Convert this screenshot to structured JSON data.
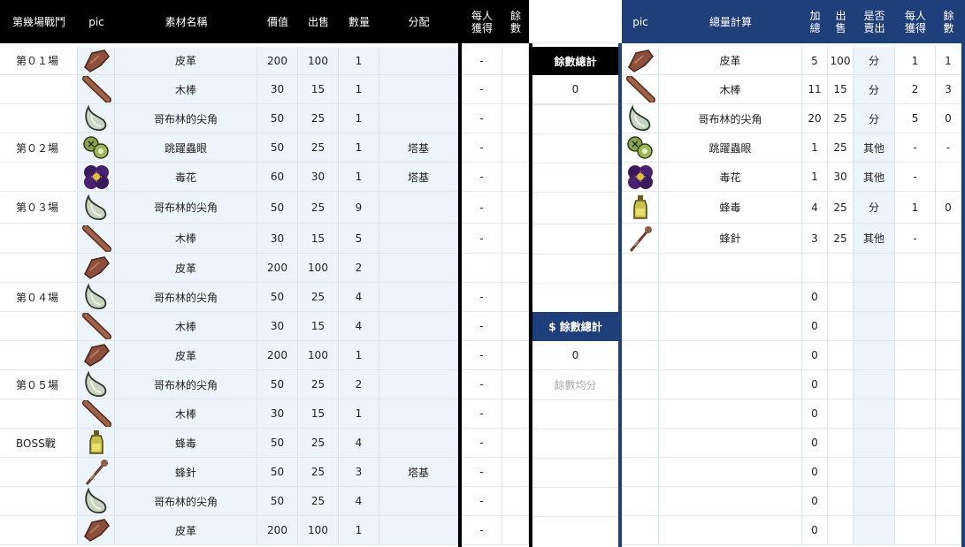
{
  "left_headers": [
    "第幾場戰鬥",
    "pic",
    "素材名稱",
    "價值",
    "出售",
    "數量",
    "分配",
    "每人\n獲得",
    "餘\n數"
  ],
  "left_rows": [
    {
      "battle": "第０１場",
      "icon": "leather-icon",
      "name": "皮革",
      "value": "200",
      "sell": "100",
      "qty": "1",
      "assign": "",
      "per": "-"
    },
    {
      "battle": "",
      "icon": "wooden-stick-icon",
      "name": "木棒",
      "value": "30",
      "sell": "15",
      "qty": "1",
      "assign": "",
      "per": "-"
    },
    {
      "battle": "",
      "icon": "goblin-horn-icon",
      "name": "哥布林的尖角",
      "value": "50",
      "sell": "25",
      "qty": "1",
      "assign": "",
      "per": "-"
    },
    {
      "battle": "第０２場",
      "icon": "bug-eye-icon",
      "name": "跳躍蟲眼",
      "value": "50",
      "sell": "25",
      "qty": "1",
      "assign": "塔基",
      "per": "-"
    },
    {
      "battle": "",
      "icon": "poison-flower-icon",
      "name": "毒花",
      "value": "60",
      "sell": "30",
      "qty": "1",
      "assign": "塔基",
      "per": "-"
    },
    {
      "battle": "第０３場",
      "icon": "goblin-horn-icon",
      "name": "哥布林的尖角",
      "value": "50",
      "sell": "25",
      "qty": "9",
      "assign": "",
      "per": "-"
    },
    {
      "battle": "",
      "icon": "wooden-stick-icon",
      "name": "木棒",
      "value": "30",
      "sell": "15",
      "qty": "5",
      "assign": "",
      "per": "-"
    },
    {
      "battle": "",
      "icon": "leather-icon",
      "name": "皮革",
      "value": "200",
      "sell": "100",
      "qty": "2",
      "assign": "",
      "per": ""
    },
    {
      "battle": "第０４場",
      "icon": "goblin-horn-icon",
      "name": "哥布林的尖角",
      "value": "50",
      "sell": "25",
      "qty": "4",
      "assign": "",
      "per": "-"
    },
    {
      "battle": "",
      "icon": "wooden-stick-icon",
      "name": "木棒",
      "value": "30",
      "sell": "15",
      "qty": "4",
      "assign": "",
      "per": "-"
    },
    {
      "battle": "",
      "icon": "leather-icon",
      "name": "皮革",
      "value": "200",
      "sell": "100",
      "qty": "1",
      "assign": "",
      "per": "-"
    },
    {
      "battle": "第０５場",
      "icon": "goblin-horn-icon",
      "name": "哥布林的尖角",
      "value": "50",
      "sell": "25",
      "qty": "2",
      "assign": "",
      "per": "-"
    },
    {
      "battle": "",
      "icon": "wooden-stick-icon",
      "name": "木棒",
      "value": "30",
      "sell": "15",
      "qty": "1",
      "assign": "",
      "per": "-"
    },
    {
      "battle": "BOSS戰",
      "icon": "bee-venom-icon",
      "name": "蜂毒",
      "value": "50",
      "sell": "25",
      "qty": "4",
      "assign": "",
      "per": "-"
    },
    {
      "battle": "",
      "icon": "bee-stinger-icon",
      "name": "蜂針",
      "value": "50",
      "sell": "25",
      "qty": "3",
      "assign": "塔基",
      "per": "-"
    },
    {
      "battle": "",
      "icon": "goblin-horn-icon",
      "name": "哥布林的尖角",
      "value": "50",
      "sell": "25",
      "qty": "4",
      "assign": "",
      "per": "-"
    },
    {
      "battle": "",
      "icon": "leather-icon",
      "name": "皮革",
      "value": "200",
      "sell": "100",
      "qty": "1",
      "assign": "",
      "per": "-"
    }
  ],
  "middle": {
    "remainder_total_label": "餘數總計",
    "remainder_total_value": "0",
    "money_remainder_label": "$ 餘數總計",
    "money_remainder_value": "0",
    "remainder_split_label": "餘數均分"
  },
  "right_headers": [
    "pic",
    "總量計算",
    "加\n總",
    "出\n售",
    "是否\n賣出",
    "每人\n獲得",
    "餘\n數"
  ],
  "right_rows": [
    {
      "icon": "leather-icon",
      "name": "皮革",
      "total": "5",
      "sell": "100",
      "sold": "分",
      "per": "1",
      "rem": "1"
    },
    {
      "icon": "wooden-stick-icon",
      "name": "木棒",
      "total": "11",
      "sell": "15",
      "sold": "分",
      "per": "2",
      "rem": "3"
    },
    {
      "icon": "goblin-horn-icon",
      "name": "哥布林的尖角",
      "total": "20",
      "sell": "25",
      "sold": "分",
      "per": "5",
      "rem": "0"
    },
    {
      "icon": "bug-eye-icon",
      "name": "跳躍蟲眼",
      "total": "1",
      "sell": "25",
      "sold": "其他",
      "per": "-",
      "rem": "-"
    },
    {
      "icon": "poison-flower-icon",
      "name": "毒花",
      "total": "1",
      "sell": "30",
      "sold": "其他",
      "per": "-",
      "rem": ""
    },
    {
      "icon": "bee-venom-icon",
      "name": "蜂毒",
      "total": "4",
      "sell": "25",
      "sold": "分",
      "per": "1",
      "rem": "0"
    },
    {
      "icon": "bee-stinger-icon",
      "name": "蜂針",
      "total": "3",
      "sell": "25",
      "sold": "其他",
      "per": "-",
      "rem": ""
    },
    {
      "icon": "",
      "name": "",
      "total": "",
      "sell": "",
      "sold": "",
      "per": "",
      "rem": ""
    },
    {
      "icon": "",
      "name": "",
      "total": "0",
      "sell": "",
      "sold": "",
      "per": "",
      "rem": ""
    },
    {
      "icon": "",
      "name": "",
      "total": "0",
      "sell": "",
      "sold": "",
      "per": "",
      "rem": ""
    },
    {
      "icon": "",
      "name": "",
      "total": "0",
      "sell": "",
      "sold": "",
      "per": "",
      "rem": ""
    },
    {
      "icon": "",
      "name": "",
      "total": "0",
      "sell": "",
      "sold": "",
      "per": "",
      "rem": ""
    },
    {
      "icon": "",
      "name": "",
      "total": "0",
      "sell": "",
      "sold": "",
      "per": "",
      "rem": ""
    },
    {
      "icon": "",
      "name": "",
      "total": "0",
      "sell": "",
      "sold": "",
      "per": "",
      "rem": ""
    },
    {
      "icon": "",
      "name": "",
      "total": "0",
      "sell": "",
      "sold": "",
      "per": "",
      "rem": ""
    },
    {
      "icon": "",
      "name": "",
      "total": "0",
      "sell": "",
      "sold": "",
      "per": "",
      "rem": ""
    },
    {
      "icon": "",
      "name": "",
      "total": "0",
      "sell": "",
      "sold": "",
      "per": "",
      "rem": ""
    }
  ],
  "colors": {
    "left_header": "#000000",
    "right_header": "#1f3f7a",
    "row_blue": "#eef4fb"
  }
}
